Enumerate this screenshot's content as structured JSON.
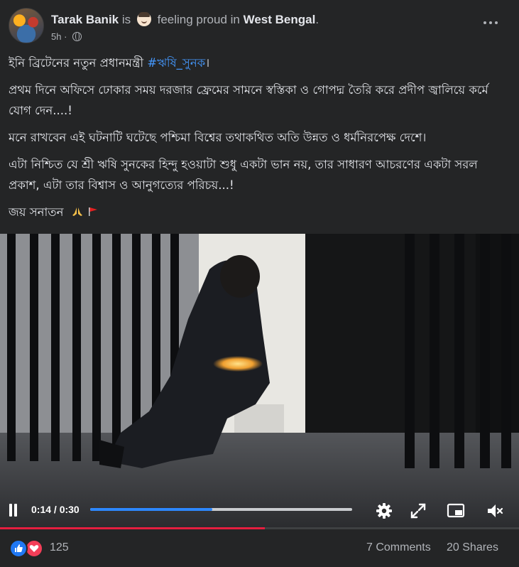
{
  "post": {
    "author": "Tarak Banik",
    "is_word": "is",
    "feeling": "feeling proud in",
    "location": "West Bengal",
    "period": ".",
    "time": "5h ·"
  },
  "body": {
    "line1_text": "ইনি ব্রিটেনের নতুন প্রধানমন্ত্রী",
    "hashtag": "#ঋষি_সুনক",
    "line1_end": "।",
    "para2": "প্রথম দিনে অফিসে ঢোকার সময় দরজার ফ্রেমের সামনে স্বস্তিকা ও গোপদ্ম তৈরি করে প্রদীপ জ্বালিয়ে কর্মে যোগ দেন....!",
    "para3": " মনে রাখবেন এই ঘটনাটি ঘটেছে পশ্চিমা বিশ্বের তথাকথিত অতি উন্নত ও ধর্মনিরপেক্ষ দেশে।",
    "para4": " এটা নিশ্চিত যে শ্রী ঋষি সুনকের হিন্দু হওয়াটা শুধু একটা ভান নয়, তার সাধারণ আচরণের একটা সরল প্রকাশ, এটা তার বিশ্বাস ও আনুগত্যের পরিচয়...!",
    "para5": "জয় সনাতন"
  },
  "video": {
    "time_display": "0:14 / 0:30",
    "progress_fraction": 0.4667,
    "buffer_fraction": 0.51
  },
  "icons": {
    "more": "more-options-icon",
    "privacy": "globe-icon",
    "pause": "pause-icon",
    "settings": "gear-icon",
    "expand": "expand-icon",
    "pip": "picture-in-picture-icon",
    "mute": "mute-icon",
    "like": "like-reaction-icon",
    "love": "love-reaction-icon"
  },
  "colors": {
    "background": "#242526",
    "text": "#e4e6eb",
    "muted": "#b0b3b8",
    "hashtag": "#4599ff",
    "scrub": "#2d88ff",
    "progress_red": "#e41e3f",
    "like_blue": "#2078f4",
    "love_red": "#f33e58"
  },
  "footer": {
    "reactions": "125",
    "comments": "7 Comments",
    "shares": "20 Shares"
  }
}
